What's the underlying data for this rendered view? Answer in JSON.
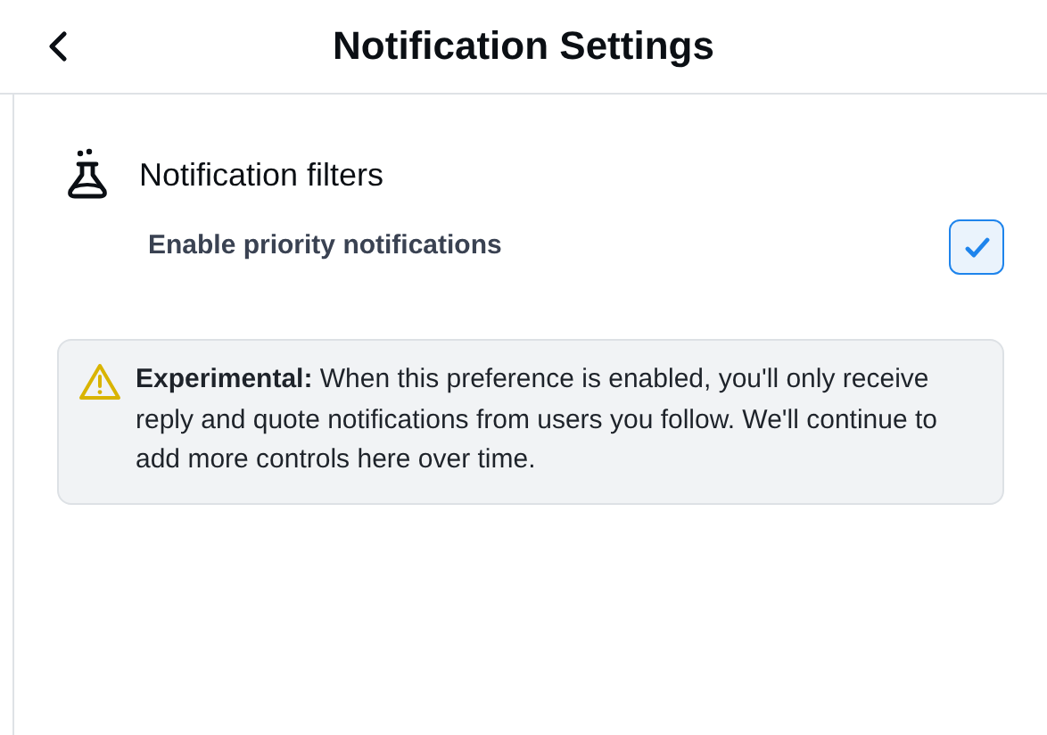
{
  "header": {
    "title": "Notification Settings"
  },
  "section": {
    "heading": "Notification filters",
    "options": [
      {
        "label": "Enable priority notifications",
        "checked": true
      }
    ]
  },
  "notice": {
    "text": "**Experimental:** When this preference is enabled, you'll only receive reply and quote notifications from users you follow. We'll continue to add more controls here over time."
  }
}
